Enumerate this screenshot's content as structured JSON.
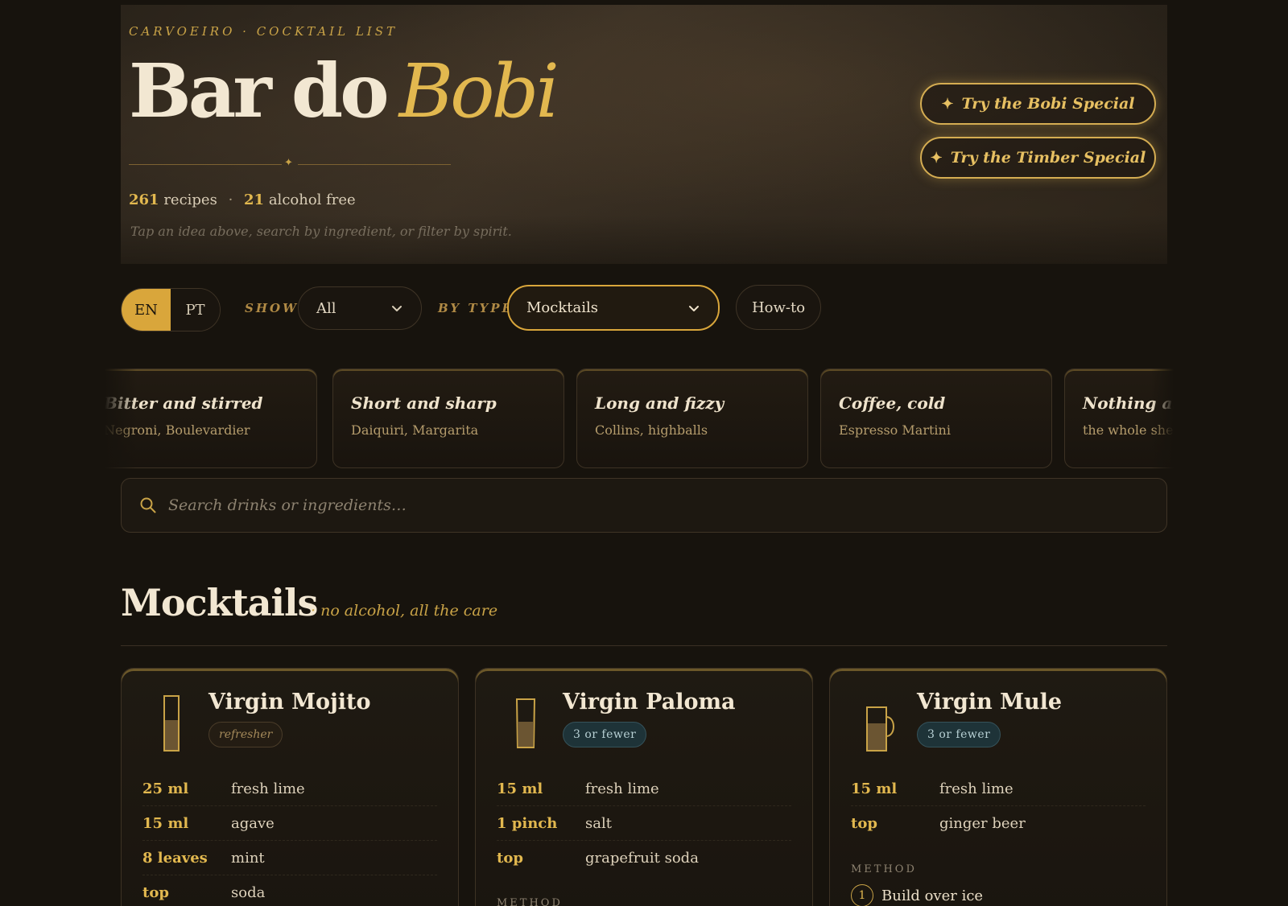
{
  "hero": {
    "kicker": "CARVOEIRO · COCKTAIL LIST",
    "title_main": "Bar do",
    "title_accent": "Bobi",
    "stats": {
      "recipes_count": "261",
      "recipes_label": "recipes",
      "sep": "·",
      "af_count": "21",
      "af_label": "alcohol free"
    },
    "hint": "Tap an idea above, search by ingredient, or filter by spirit.",
    "specials": [
      {
        "label": "Try the Bobi Special",
        "icon": "sparkle-icon"
      },
      {
        "label": "Try the Timber Special",
        "icon": "sparkle-icon"
      }
    ]
  },
  "controls": {
    "languages": [
      {
        "label": "EN",
        "active": true
      },
      {
        "label": "PT",
        "active": false
      }
    ],
    "show_label": "SHOW",
    "show_value": "All",
    "type_label": "BY TYPE",
    "type_value": "Mocktails",
    "howto_label": "How-to"
  },
  "ideas": [
    {
      "title": "Bitter and stirred",
      "sub": "Negroni, Boulevardier"
    },
    {
      "title": "Short and sharp",
      "sub": "Daiquiri, Margarita"
    },
    {
      "title": "Long and fizzy",
      "sub": "Collins, highballs"
    },
    {
      "title": "Coffee, cold",
      "sub": "Espresso Martini"
    },
    {
      "title": "Nothing alco",
      "sub": "the whole shelf o"
    }
  ],
  "search": {
    "placeholder": "Search drinks or ingredients…",
    "icon": "search-icon"
  },
  "section": {
    "title": "Mocktails",
    "subtitle": "· no alcohol, all the care"
  },
  "recipes": [
    {
      "name": "Virgin Mojito",
      "tag": "refresher",
      "glass": "highball-glass-icon",
      "ingredients": [
        {
          "qty": "25 ml",
          "name": "fresh lime"
        },
        {
          "qty": "15 ml",
          "name": "agave"
        },
        {
          "qty": "8 leaves",
          "name": "mint"
        },
        {
          "qty": "top",
          "name": "soda"
        }
      ]
    },
    {
      "name": "Virgin Paloma",
      "tag": "3 or fewer",
      "glass": "collins-glass-icon",
      "ingredients": [
        {
          "qty": "15 ml",
          "name": "fresh lime"
        },
        {
          "qty": "1 pinch",
          "name": "salt"
        },
        {
          "qty": "top",
          "name": "grapefruit soda"
        }
      ],
      "method_label": "METHOD"
    },
    {
      "name": "Virgin Mule",
      "tag": "3 or fewer",
      "glass": "mule-mug-icon",
      "ingredients": [
        {
          "qty": "15 ml",
          "name": "fresh lime"
        },
        {
          "qty": "top",
          "name": "ginger beer"
        }
      ],
      "method_label": "METHOD",
      "steps": [
        {
          "num": "1",
          "text": "Build over ice"
        }
      ]
    }
  ]
}
